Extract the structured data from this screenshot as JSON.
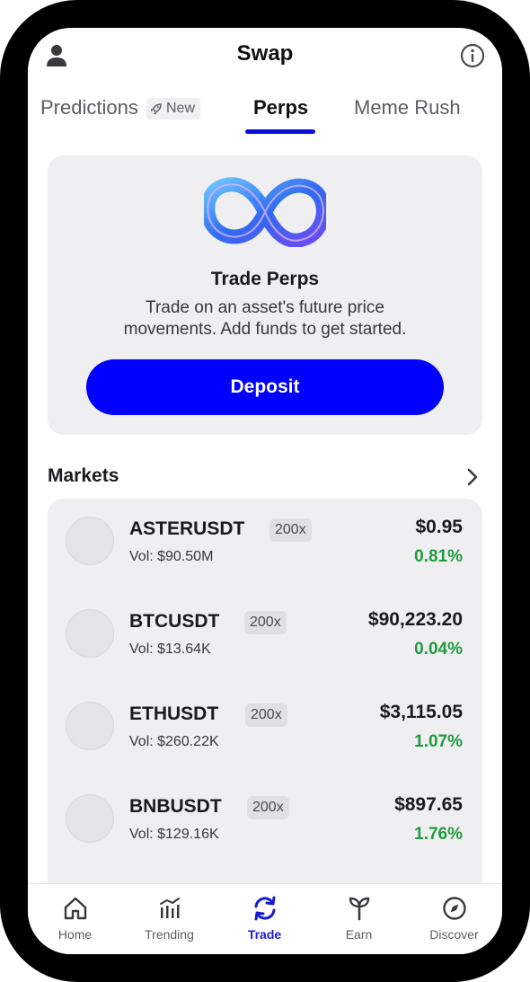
{
  "header": {
    "title": "Swap"
  },
  "tabs": {
    "predictions": "Predictions",
    "new_badge": "New",
    "perps": "Perps",
    "meme_rush": "Meme Rush",
    "active": "Perps"
  },
  "promo": {
    "title": "Trade Perps",
    "description_line1": "Trade on an asset's future price",
    "description_line2": "movements. Add funds to get started.",
    "deposit_label": "Deposit"
  },
  "markets": {
    "title": "Markets",
    "rows": [
      {
        "symbol": "ASTERUSDT",
        "leverage": "200x",
        "vol": "Vol: $90.50M",
        "price": "$0.95",
        "change": "0.81%"
      },
      {
        "symbol": "BTCUSDT",
        "leverage": "200x",
        "vol": "Vol: $13.64K",
        "price": "$90,223.20",
        "change": "0.04%"
      },
      {
        "symbol": "ETHUSDT",
        "leverage": "200x",
        "vol": "Vol: $260.22K",
        "price": "$3,115.05",
        "change": "1.07%"
      },
      {
        "symbol": "BNBUSDT",
        "leverage": "200x",
        "vol": "Vol: $129.16K",
        "price": "$897.65",
        "change": "1.76%"
      }
    ]
  },
  "nav": {
    "items": [
      {
        "label": "Home",
        "icon": "home-icon"
      },
      {
        "label": "Trending",
        "icon": "trending-icon"
      },
      {
        "label": "Trade",
        "icon": "trade-icon"
      },
      {
        "label": "Earn",
        "icon": "earn-icon"
      },
      {
        "label": "Discover",
        "icon": "compass-icon"
      }
    ],
    "active": "Trade"
  },
  "colors": {
    "accent": "#0000ff",
    "positive": "#1e9b3c",
    "card_bg": "#efeff1"
  }
}
